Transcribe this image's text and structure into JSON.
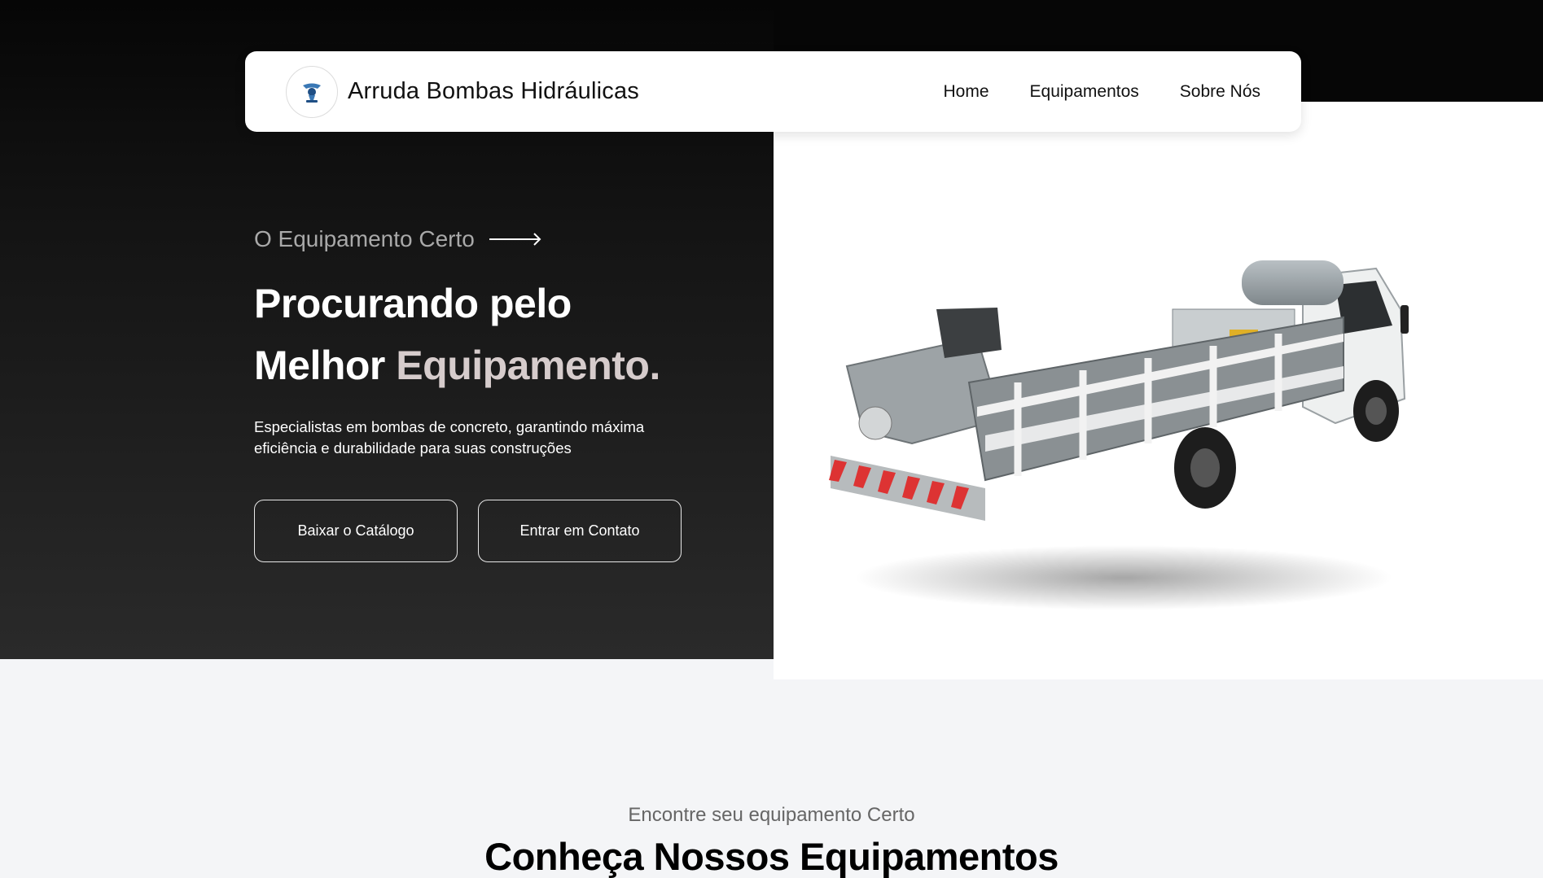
{
  "brand": {
    "name": "Arruda Bombas Hidráulicas",
    "logo_icon": "pump-logo-icon"
  },
  "nav": {
    "items": [
      {
        "label": "Home"
      },
      {
        "label": "Equipamentos"
      },
      {
        "label": "Sobre Nós"
      }
    ]
  },
  "hero": {
    "eyebrow": "O Equipamento Certo",
    "arrow_icon": "arrow-right-icon",
    "headline_line1": "Procurando pelo",
    "headline_line2_plain": "Melhor ",
    "headline_line2_accent": "Equipamento.",
    "subtext": "Especialistas em bombas de concreto, garantindo máxima eficiência e durabilidade para suas construções",
    "buttons": {
      "catalog": "Baixar o Catálogo",
      "contact": "Entrar em Contato"
    },
    "image": "concrete-pump-truck-image"
  },
  "equipment_section": {
    "eyebrow": "Encontre seu equipamento Certo",
    "title": "Conheça Nossos Equipamentos"
  },
  "colors": {
    "hero_dark": "#141414",
    "accent_text": "#d6cccc",
    "page_bg": "#f4f5f7"
  }
}
